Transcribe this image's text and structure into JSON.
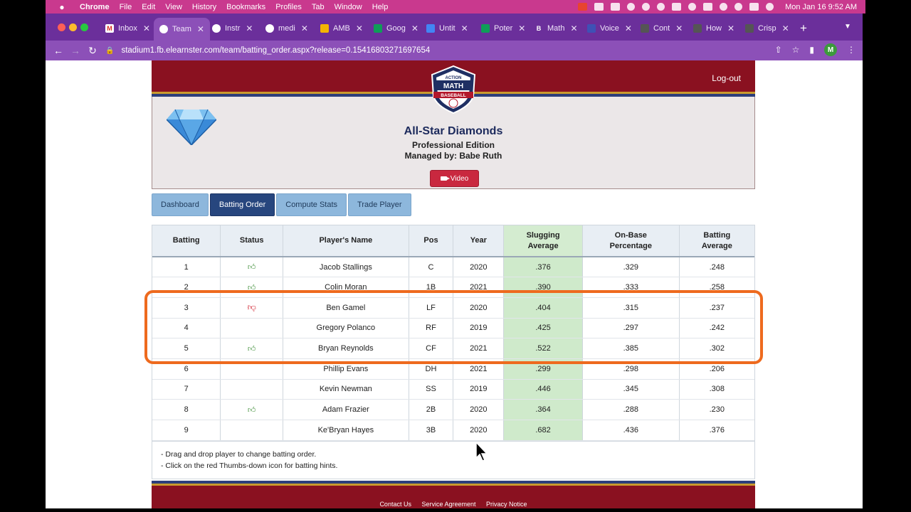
{
  "menubar": {
    "app": "Chrome",
    "items": [
      "File",
      "Edit",
      "View",
      "History",
      "Bookmarks",
      "Profiles",
      "Tab",
      "Window",
      "Help"
    ],
    "clock": "Mon Jan 16  9:52 AM"
  },
  "tabs": [
    {
      "label": "Inbox",
      "fav": "M",
      "color": "#ffffff",
      "favcolor": "#d93025"
    },
    {
      "label": "Team",
      "fav": "",
      "color": "#ffffff",
      "favcolor": "#ffffff"
    },
    {
      "label": "Instr",
      "fav": "",
      "color": "#ffffff",
      "favcolor": "#ffffff"
    },
    {
      "label": "medi",
      "fav": "",
      "color": "#ffffff",
      "favcolor": "#ffffff"
    },
    {
      "label": "AMB",
      "fav": "",
      "color": "#ffffff",
      "favcolor": "#f4b400"
    },
    {
      "label": "Goog",
      "fav": "",
      "color": "#ffffff",
      "favcolor": "#0f9d58"
    },
    {
      "label": "Untit",
      "fav": "",
      "color": "#ffffff",
      "favcolor": "#4285f4"
    },
    {
      "label": "Poter",
      "fav": "",
      "color": "#ffffff",
      "favcolor": "#0f9d58"
    },
    {
      "label": "Math",
      "fav": "B",
      "color": "#ffffff",
      "favcolor": "#6b2f9b"
    },
    {
      "label": "Voice",
      "fav": "",
      "color": "#ffffff",
      "favcolor": "#3f51b5"
    },
    {
      "label": "Cont",
      "fav": "",
      "color": "#ffffff",
      "favcolor": "#555555"
    },
    {
      "label": "How",
      "fav": "",
      "color": "#ffffff",
      "favcolor": "#555555"
    },
    {
      "label": "Crisp",
      "fav": "",
      "color": "#ffffff",
      "favcolor": "#555555"
    }
  ],
  "address": "stadium1.fb.elearnster.com/team/batting_order.aspx?release=0.15416803271697654",
  "profile_initial": "M",
  "header": {
    "logout": "Log-out",
    "logo_line1": "ACTION",
    "logo_line2": "MATH",
    "logo_line3": "BASEBALL"
  },
  "banner": {
    "team_name": "All-Star Diamonds",
    "edition": "Professional Edition",
    "manager": "Managed by: Babe Ruth",
    "video_label": "Video"
  },
  "nav": {
    "dashboard": "Dashboard",
    "batting_order": "Batting Order",
    "compute_stats": "Compute Stats",
    "trade_player": "Trade Player"
  },
  "table": {
    "headers": {
      "batting": "Batting",
      "status": "Status",
      "player": "Player's Name",
      "pos": "Pos",
      "year": "Year",
      "slg1": "Slugging",
      "slg2": "Average",
      "obp1": "On-Base",
      "obp2": "Percentage",
      "avg1": "Batting",
      "avg2": "Average"
    },
    "rows": [
      {
        "batting": "1",
        "status": "up",
        "player": "Jacob Stallings",
        "pos": "C",
        "year": "2020",
        "slg": ".376",
        "obp": ".329",
        "avg": ".248"
      },
      {
        "batting": "2",
        "status": "up",
        "player": "Colin Moran",
        "pos": "1B",
        "year": "2021",
        "slg": ".390",
        "obp": ".333",
        "avg": ".258"
      },
      {
        "batting": "3",
        "status": "down",
        "player": "Ben Gamel",
        "pos": "LF",
        "year": "2020",
        "slg": ".404",
        "obp": ".315",
        "avg": ".237"
      },
      {
        "batting": "4",
        "status": "",
        "player": "Gregory Polanco",
        "pos": "RF",
        "year": "2019",
        "slg": ".425",
        "obp": ".297",
        "avg": ".242"
      },
      {
        "batting": "5",
        "status": "up",
        "player": "Bryan Reynolds",
        "pos": "CF",
        "year": "2021",
        "slg": ".522",
        "obp": ".385",
        "avg": ".302"
      },
      {
        "batting": "6",
        "status": "",
        "player": "Phillip Evans",
        "pos": "DH",
        "year": "2021",
        "slg": ".299",
        "obp": ".298",
        "avg": ".206"
      },
      {
        "batting": "7",
        "status": "",
        "player": "Kevin Newman",
        "pos": "SS",
        "year": "2019",
        "slg": ".446",
        "obp": ".345",
        "avg": ".308"
      },
      {
        "batting": "8",
        "status": "up",
        "player": "Adam Frazier",
        "pos": "2B",
        "year": "2020",
        "slg": ".364",
        "obp": ".288",
        "avg": ".230"
      },
      {
        "batting": "9",
        "status": "",
        "player": "Ke'Bryan Hayes",
        "pos": "3B",
        "year": "2020",
        "slg": ".682",
        "obp": ".436",
        "avg": ".376"
      }
    ]
  },
  "hints": {
    "line1": "- Drag and drop player to change batting order.",
    "line2": "- Click on the red Thumbs-down icon for batting hints."
  },
  "footer": {
    "contact": "Contact Us",
    "service": "Service Agreement",
    "privacy": "Privacy Notice"
  },
  "colors": {
    "menubar": "#c9398e",
    "chrome_frame": "#6b2f9b",
    "header_red": "#8a1120",
    "active_tab_blue": "#27467e",
    "slugging_green": "#cfeacb",
    "highlight_orange": "#ee6a1e"
  }
}
